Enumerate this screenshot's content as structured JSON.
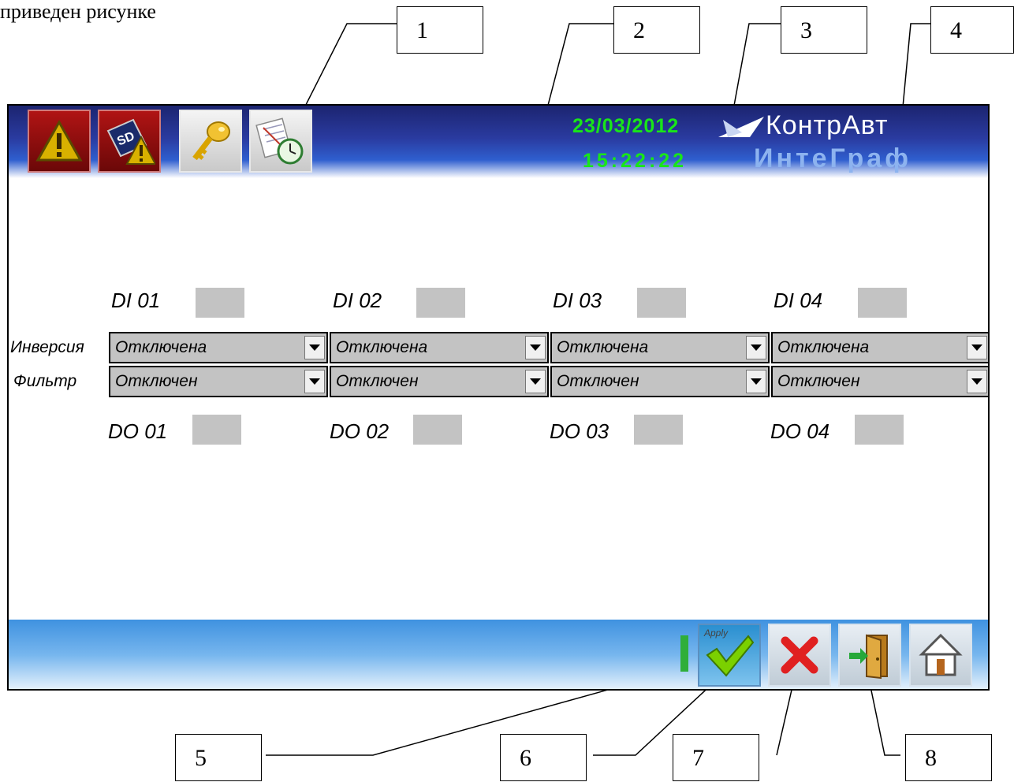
{
  "header_text": "приведен рисунке",
  "callouts": [
    "1",
    "2",
    "3",
    "4",
    "5",
    "6",
    "7",
    "8"
  ],
  "datetime": {
    "date": "23/03/2012",
    "time": "15:22:22"
  },
  "brand": {
    "line1": "КонтрАвт",
    "line2": "ИнтеГраф"
  },
  "toolbar_icons": [
    "alarm-icon",
    "sd-card-warning-icon",
    "key-icon",
    "log-clock-icon"
  ],
  "channels": [
    {
      "di": "DI 01",
      "do": "DO 01",
      "inversion": "Отключена",
      "filter": "Отключен"
    },
    {
      "di": "DI 02",
      "do": "DO 02",
      "inversion": "Отключена",
      "filter": "Отключен"
    },
    {
      "di": "DI 03",
      "do": "DO 03",
      "inversion": "Отключена",
      "filter": "Отключен"
    },
    {
      "di": "DI 04",
      "do": "DO 04",
      "inversion": "Отключена",
      "filter": "Отключен"
    }
  ],
  "row_labels": {
    "inversion": "Инверсия",
    "filter": "Фильтр"
  },
  "bottom_buttons": {
    "apply_label": "Apply"
  },
  "colors": {
    "topbar": "#2a3ba0",
    "datetime": "#19e619",
    "indicator": "#c3c3c3",
    "bottombar": "#77b6ee"
  }
}
